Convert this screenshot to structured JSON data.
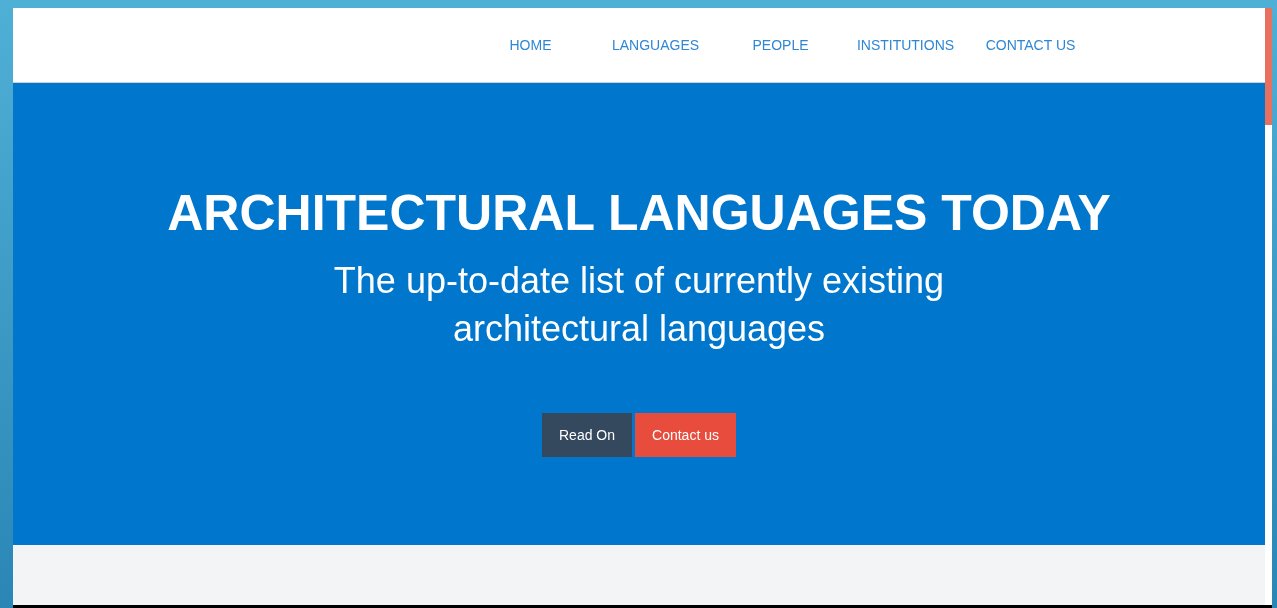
{
  "nav": {
    "items": [
      {
        "label": "HOME"
      },
      {
        "label": "LANGUAGES"
      },
      {
        "label": "PEOPLE"
      },
      {
        "label": "INSTITUTIONS"
      },
      {
        "label": "CONTACT US"
      }
    ]
  },
  "hero": {
    "title": "ARCHITECTURAL LANGUAGES TODAY",
    "subtitle_lines": [
      "The up-to-date list of currently existing",
      "architectural languages"
    ],
    "buttons": [
      {
        "label": "Read On",
        "kind": "dark"
      },
      {
        "label": "Contact us",
        "kind": "accent"
      }
    ]
  }
}
